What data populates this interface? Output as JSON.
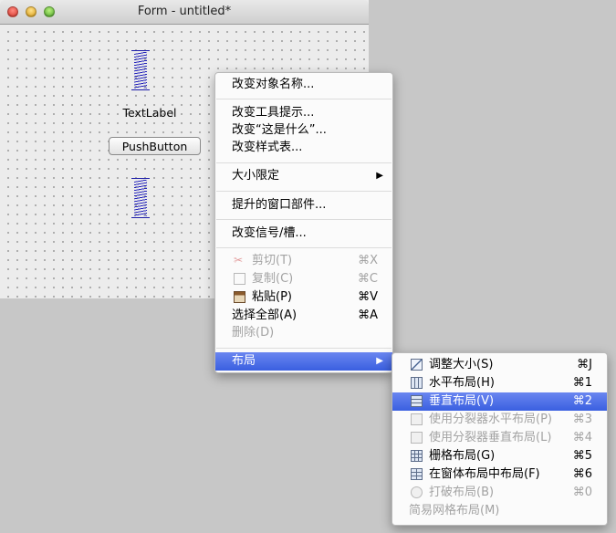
{
  "window": {
    "title": "Form - untitled*",
    "text_label": "TextLabel",
    "push_button": "PushButton"
  },
  "context_menu": {
    "items": [
      {
        "label": "改变对象名称..."
      },
      {
        "label": "改变工具提示..."
      },
      {
        "label": "改变“这是什么”..."
      },
      {
        "label": "改变样式表..."
      },
      {
        "label": "大小限定",
        "submenu_arrow": "▶"
      },
      {
        "label": "提升的窗口部件..."
      },
      {
        "label": "改变信号/槽..."
      },
      {
        "label": "剪切(T)",
        "shortcut": "⌘X",
        "disabled": true,
        "icon": "scissors-icon"
      },
      {
        "label": "复制(C)",
        "shortcut": "⌘C",
        "disabled": true,
        "icon": "copy-icon"
      },
      {
        "label": "粘贴(P)",
        "shortcut": "⌘V",
        "icon": "paste-icon"
      },
      {
        "label": "选择全部(A)",
        "shortcut": "⌘A"
      },
      {
        "label": "删除(D)",
        "disabled": true
      },
      {
        "label": "布局",
        "submenu_arrow": "▶",
        "highlighted": true
      }
    ]
  },
  "layout_submenu": {
    "items": [
      {
        "label": "调整大小(S)",
        "shortcut": "⌘J",
        "icon": "adjust-size-icon"
      },
      {
        "label": "水平布局(H)",
        "shortcut": "⌘1",
        "icon": "horizontal-layout-icon"
      },
      {
        "label": "垂直布局(V)",
        "shortcut": "⌘2",
        "icon": "vertical-layout-icon",
        "highlighted": true
      },
      {
        "label": "使用分裂器水平布局(P)",
        "shortcut": "⌘3",
        "icon": "horizontal-splitter-icon",
        "disabled": true
      },
      {
        "label": "使用分裂器垂直布局(L)",
        "shortcut": "⌘4",
        "icon": "vertical-splitter-icon",
        "disabled": true
      },
      {
        "label": "栅格布局(G)",
        "shortcut": "⌘5",
        "icon": "grid-layout-icon"
      },
      {
        "label": "在窗体布局中布局(F)",
        "shortcut": "⌘6",
        "icon": "form-layout-icon"
      },
      {
        "label": "打破布局(B)",
        "shortcut": "⌘0",
        "icon": "break-layout-icon",
        "disabled": true
      },
      {
        "label": "简易网格布局(M)",
        "disabled": true
      }
    ]
  },
  "colors": {
    "highlight": "#3a5fe0",
    "spacer": "#1d1da8",
    "disabled_text": "#a3a3a3"
  }
}
